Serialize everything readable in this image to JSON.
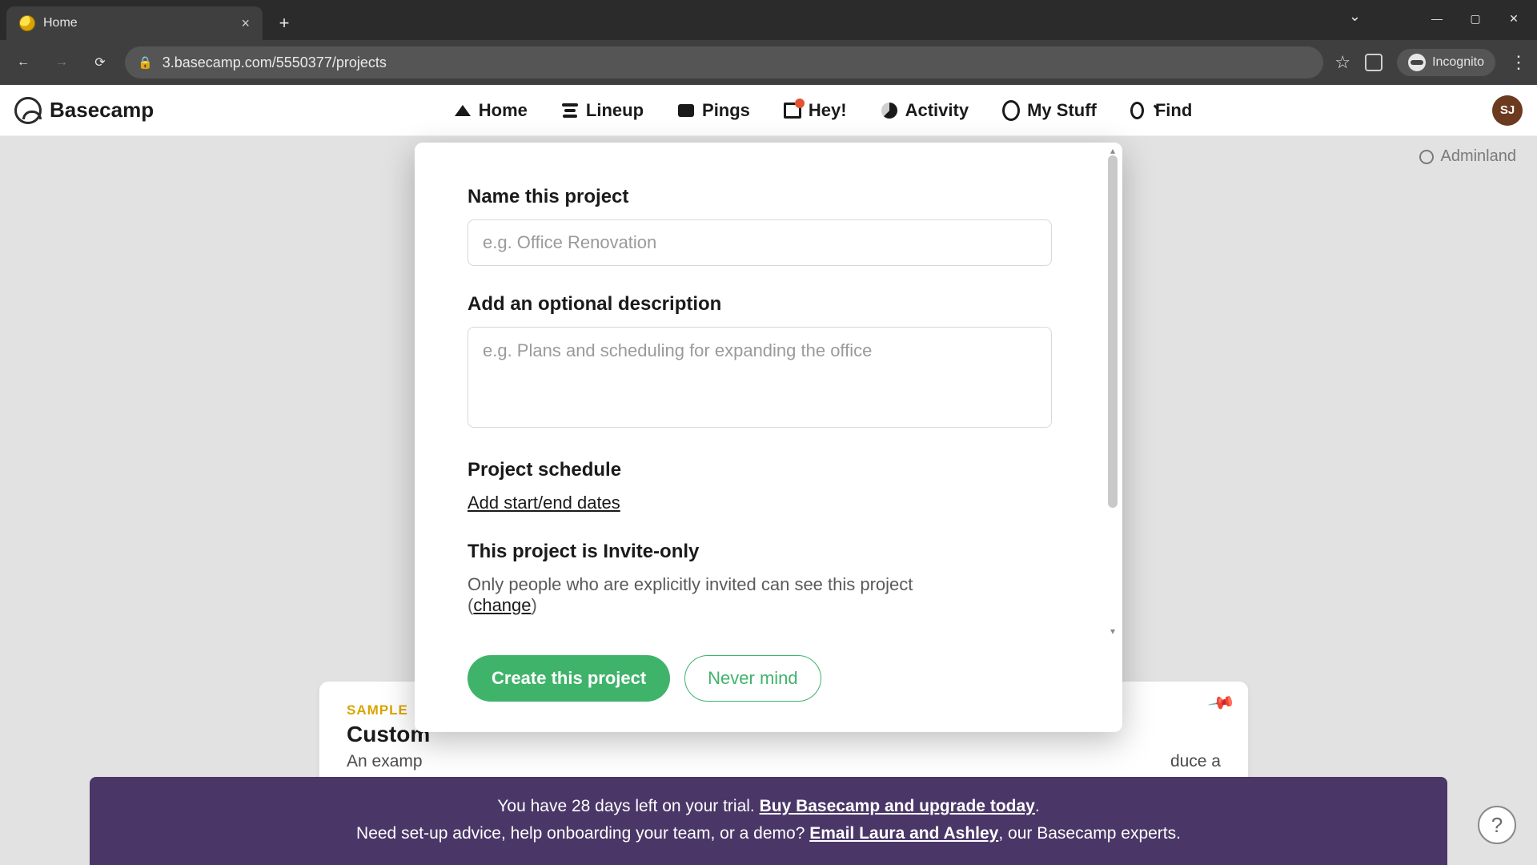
{
  "browser": {
    "tab_title": "Home",
    "url": "3.basecamp.com/5550377/projects",
    "incognito_label": "Incognito"
  },
  "nav": {
    "logo_text": "Basecamp",
    "items": {
      "home": "Home",
      "lineup": "Lineup",
      "pings": "Pings",
      "hey": "Hey!",
      "activity": "Activity",
      "mystuff": "My Stuff",
      "find": "Find"
    },
    "avatar_initials": "SJ",
    "adminland": "Adminland"
  },
  "modal": {
    "name_label": "Name this project",
    "name_placeholder": "e.g. Office Renovation",
    "name_value": "",
    "desc_label": "Add an optional description",
    "desc_placeholder": "e.g. Plans and scheduling for expanding the office",
    "desc_value": "",
    "schedule_label": "Project schedule",
    "schedule_link": "Add start/end dates",
    "invite_label": "This project is Invite-only",
    "invite_desc": "Only people who are explicitly invited can see this project",
    "invite_change": "change",
    "create_btn": "Create this project",
    "cancel_btn": "Never mind"
  },
  "peek": {
    "sample": "SAMPLE",
    "title_fragment": "Custom",
    "desc_left": "An examp",
    "desc_right": "duce a"
  },
  "banner": {
    "line1_pre": "You have 28 days left on your trial. ",
    "line1_link": "Buy Basecamp and upgrade today",
    "line1_post": ".",
    "line2_pre": "Need set-up advice, help onboarding your team, or a demo? ",
    "line2_link": "Email Laura and Ashley",
    "line2_post": ", our Basecamp experts."
  },
  "help": "?"
}
